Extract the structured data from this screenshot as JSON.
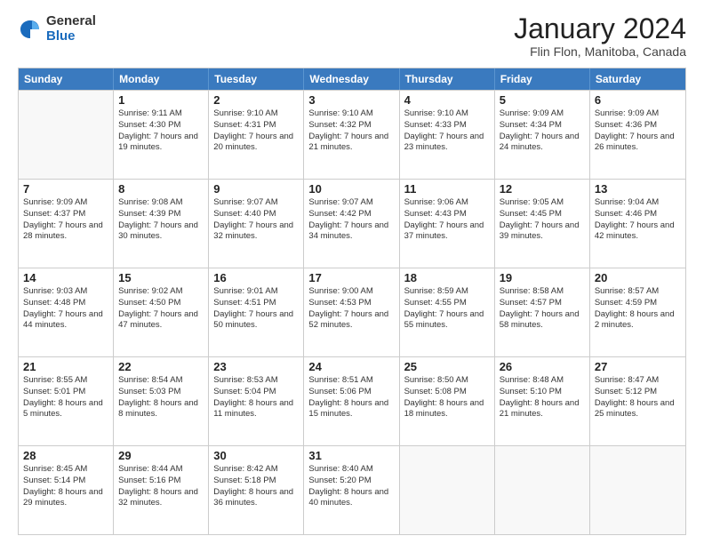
{
  "logo": {
    "general": "General",
    "blue": "Blue"
  },
  "header": {
    "title": "January 2024",
    "location": "Flin Flon, Manitoba, Canada"
  },
  "days_of_week": [
    "Sunday",
    "Monday",
    "Tuesday",
    "Wednesday",
    "Thursday",
    "Friday",
    "Saturday"
  ],
  "weeks": [
    [
      {
        "day": "",
        "sunrise": "",
        "sunset": "",
        "daylight": ""
      },
      {
        "day": "1",
        "sunrise": "Sunrise: 9:11 AM",
        "sunset": "Sunset: 4:30 PM",
        "daylight": "Daylight: 7 hours and 19 minutes."
      },
      {
        "day": "2",
        "sunrise": "Sunrise: 9:10 AM",
        "sunset": "Sunset: 4:31 PM",
        "daylight": "Daylight: 7 hours and 20 minutes."
      },
      {
        "day": "3",
        "sunrise": "Sunrise: 9:10 AM",
        "sunset": "Sunset: 4:32 PM",
        "daylight": "Daylight: 7 hours and 21 minutes."
      },
      {
        "day": "4",
        "sunrise": "Sunrise: 9:10 AM",
        "sunset": "Sunset: 4:33 PM",
        "daylight": "Daylight: 7 hours and 23 minutes."
      },
      {
        "day": "5",
        "sunrise": "Sunrise: 9:09 AM",
        "sunset": "Sunset: 4:34 PM",
        "daylight": "Daylight: 7 hours and 24 minutes."
      },
      {
        "day": "6",
        "sunrise": "Sunrise: 9:09 AM",
        "sunset": "Sunset: 4:36 PM",
        "daylight": "Daylight: 7 hours and 26 minutes."
      }
    ],
    [
      {
        "day": "7",
        "sunrise": "Sunrise: 9:09 AM",
        "sunset": "Sunset: 4:37 PM",
        "daylight": "Daylight: 7 hours and 28 minutes."
      },
      {
        "day": "8",
        "sunrise": "Sunrise: 9:08 AM",
        "sunset": "Sunset: 4:39 PM",
        "daylight": "Daylight: 7 hours and 30 minutes."
      },
      {
        "day": "9",
        "sunrise": "Sunrise: 9:07 AM",
        "sunset": "Sunset: 4:40 PM",
        "daylight": "Daylight: 7 hours and 32 minutes."
      },
      {
        "day": "10",
        "sunrise": "Sunrise: 9:07 AM",
        "sunset": "Sunset: 4:42 PM",
        "daylight": "Daylight: 7 hours and 34 minutes."
      },
      {
        "day": "11",
        "sunrise": "Sunrise: 9:06 AM",
        "sunset": "Sunset: 4:43 PM",
        "daylight": "Daylight: 7 hours and 37 minutes."
      },
      {
        "day": "12",
        "sunrise": "Sunrise: 9:05 AM",
        "sunset": "Sunset: 4:45 PM",
        "daylight": "Daylight: 7 hours and 39 minutes."
      },
      {
        "day": "13",
        "sunrise": "Sunrise: 9:04 AM",
        "sunset": "Sunset: 4:46 PM",
        "daylight": "Daylight: 7 hours and 42 minutes."
      }
    ],
    [
      {
        "day": "14",
        "sunrise": "Sunrise: 9:03 AM",
        "sunset": "Sunset: 4:48 PM",
        "daylight": "Daylight: 7 hours and 44 minutes."
      },
      {
        "day": "15",
        "sunrise": "Sunrise: 9:02 AM",
        "sunset": "Sunset: 4:50 PM",
        "daylight": "Daylight: 7 hours and 47 minutes."
      },
      {
        "day": "16",
        "sunrise": "Sunrise: 9:01 AM",
        "sunset": "Sunset: 4:51 PM",
        "daylight": "Daylight: 7 hours and 50 minutes."
      },
      {
        "day": "17",
        "sunrise": "Sunrise: 9:00 AM",
        "sunset": "Sunset: 4:53 PM",
        "daylight": "Daylight: 7 hours and 52 minutes."
      },
      {
        "day": "18",
        "sunrise": "Sunrise: 8:59 AM",
        "sunset": "Sunset: 4:55 PM",
        "daylight": "Daylight: 7 hours and 55 minutes."
      },
      {
        "day": "19",
        "sunrise": "Sunrise: 8:58 AM",
        "sunset": "Sunset: 4:57 PM",
        "daylight": "Daylight: 7 hours and 58 minutes."
      },
      {
        "day": "20",
        "sunrise": "Sunrise: 8:57 AM",
        "sunset": "Sunset: 4:59 PM",
        "daylight": "Daylight: 8 hours and 2 minutes."
      }
    ],
    [
      {
        "day": "21",
        "sunrise": "Sunrise: 8:55 AM",
        "sunset": "Sunset: 5:01 PM",
        "daylight": "Daylight: 8 hours and 5 minutes."
      },
      {
        "day": "22",
        "sunrise": "Sunrise: 8:54 AM",
        "sunset": "Sunset: 5:03 PM",
        "daylight": "Daylight: 8 hours and 8 minutes."
      },
      {
        "day": "23",
        "sunrise": "Sunrise: 8:53 AM",
        "sunset": "Sunset: 5:04 PM",
        "daylight": "Daylight: 8 hours and 11 minutes."
      },
      {
        "day": "24",
        "sunrise": "Sunrise: 8:51 AM",
        "sunset": "Sunset: 5:06 PM",
        "daylight": "Daylight: 8 hours and 15 minutes."
      },
      {
        "day": "25",
        "sunrise": "Sunrise: 8:50 AM",
        "sunset": "Sunset: 5:08 PM",
        "daylight": "Daylight: 8 hours and 18 minutes."
      },
      {
        "day": "26",
        "sunrise": "Sunrise: 8:48 AM",
        "sunset": "Sunset: 5:10 PM",
        "daylight": "Daylight: 8 hours and 21 minutes."
      },
      {
        "day": "27",
        "sunrise": "Sunrise: 8:47 AM",
        "sunset": "Sunset: 5:12 PM",
        "daylight": "Daylight: 8 hours and 25 minutes."
      }
    ],
    [
      {
        "day": "28",
        "sunrise": "Sunrise: 8:45 AM",
        "sunset": "Sunset: 5:14 PM",
        "daylight": "Daylight: 8 hours and 29 minutes."
      },
      {
        "day": "29",
        "sunrise": "Sunrise: 8:44 AM",
        "sunset": "Sunset: 5:16 PM",
        "daylight": "Daylight: 8 hours and 32 minutes."
      },
      {
        "day": "30",
        "sunrise": "Sunrise: 8:42 AM",
        "sunset": "Sunset: 5:18 PM",
        "daylight": "Daylight: 8 hours and 36 minutes."
      },
      {
        "day": "31",
        "sunrise": "Sunrise: 8:40 AM",
        "sunset": "Sunset: 5:20 PM",
        "daylight": "Daylight: 8 hours and 40 minutes."
      },
      {
        "day": "",
        "sunrise": "",
        "sunset": "",
        "daylight": ""
      },
      {
        "day": "",
        "sunrise": "",
        "sunset": "",
        "daylight": ""
      },
      {
        "day": "",
        "sunrise": "",
        "sunset": "",
        "daylight": ""
      }
    ]
  ]
}
